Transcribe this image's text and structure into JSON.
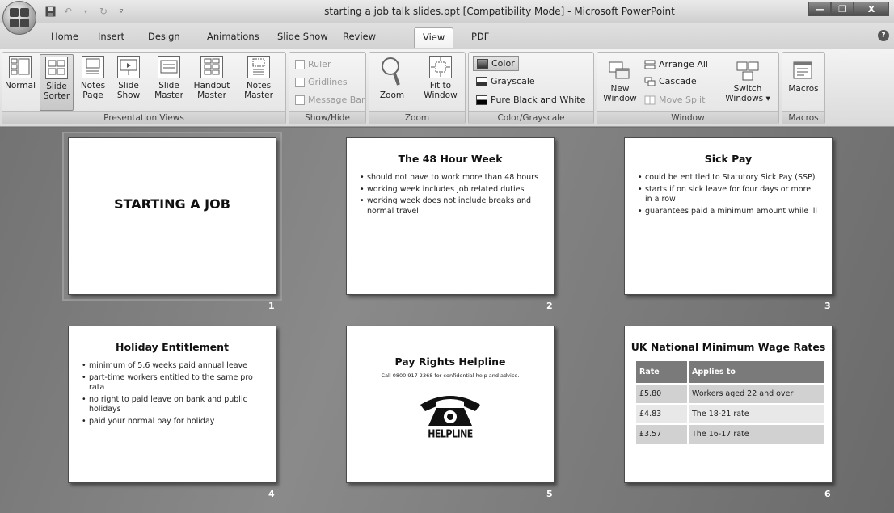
{
  "window": {
    "title": "starting a job talk slides.ppt [Compatibility Mode] - Microsoft PowerPoint",
    "controls": [
      "—",
      "❐",
      "X"
    ]
  },
  "qat": {
    "save_icon": "save-icon",
    "undo_icon": "undo-icon",
    "redo_icon": "redo-icon",
    "customize_icon": "customize-qat-icon"
  },
  "tabs": [
    {
      "label": "Home"
    },
    {
      "label": "Insert"
    },
    {
      "label": "Design"
    },
    {
      "label": "Animations"
    },
    {
      "label": "Slide Show"
    },
    {
      "label": "Review"
    },
    {
      "label": "View"
    },
    {
      "label": "PDF"
    }
  ],
  "active_tab": "View",
  "ribbon": {
    "presentation_views": {
      "label": "Presentation Views",
      "buttons": [
        {
          "line1": "Normal",
          "line2": ""
        },
        {
          "line1": "Slide",
          "line2": "Sorter"
        },
        {
          "line1": "Notes",
          "line2": "Page"
        },
        {
          "line1": "Slide",
          "line2": "Show"
        },
        {
          "line1": "Slide",
          "line2": "Master"
        },
        {
          "line1": "Handout",
          "line2": "Master"
        },
        {
          "line1": "Notes",
          "line2": "Master"
        }
      ],
      "selected": "Slide Sorter"
    },
    "show_hide": {
      "label": "Show/Hide",
      "ruler": "Ruler",
      "gridlines": "Gridlines",
      "message_bar": "Message Bar"
    },
    "zoom": {
      "label": "Zoom",
      "zoom_btn": "Zoom",
      "fit1": "Fit to",
      "fit2": "Window"
    },
    "color": {
      "label": "Color/Grayscale",
      "color": "Color",
      "grayscale": "Grayscale",
      "pure": "Pure Black and White"
    },
    "window": {
      "label": "Window",
      "new1": "New",
      "new2": "Window",
      "arrange_all": "Arrange All",
      "cascade": "Cascade",
      "move_split": "Move Split",
      "switch1": "Switch",
      "switch2": "Windows ▾"
    },
    "macros": {
      "label": "Macros",
      "btn": "Macros"
    }
  },
  "slides": [
    {
      "num": "1",
      "title": "STARTING A JOB"
    },
    {
      "num": "2",
      "title": "The 48 Hour Week",
      "bullets": [
        "should not have to work more than 48 hours",
        "working week includes job related duties",
        "working week does not include breaks and normal travel"
      ]
    },
    {
      "num": "3",
      "title": "Sick Pay",
      "bullets": [
        "could be entitled to Statutory Sick Pay (SSP)",
        "starts if on sick leave for four days or more in a row",
        "guarantees paid a minimum amount while ill"
      ]
    },
    {
      "num": "4",
      "title": "Holiday Entitlement",
      "bullets": [
        "minimum of 5.6 weeks paid annual leave",
        "part-time workers entitled to the same pro rata",
        "no right to paid leave on bank and public holidays",
        "paid your normal pay for holiday"
      ]
    },
    {
      "num": "5",
      "title": "Pay Rights Helpline",
      "subtitle": "Call 0800 917 2368 for confidential help and advice.",
      "helpline_label": "HELPLINE"
    },
    {
      "num": "6",
      "title": "UK National Minimum Wage Rates",
      "table": {
        "headers": [
          "Rate",
          "Applies to"
        ],
        "rows": [
          [
            "£5.80",
            "Workers aged 22 and over"
          ],
          [
            "£4.83",
            "The 18-21 rate"
          ],
          [
            "£3.57",
            "The 16-17 rate"
          ]
        ]
      }
    }
  ]
}
